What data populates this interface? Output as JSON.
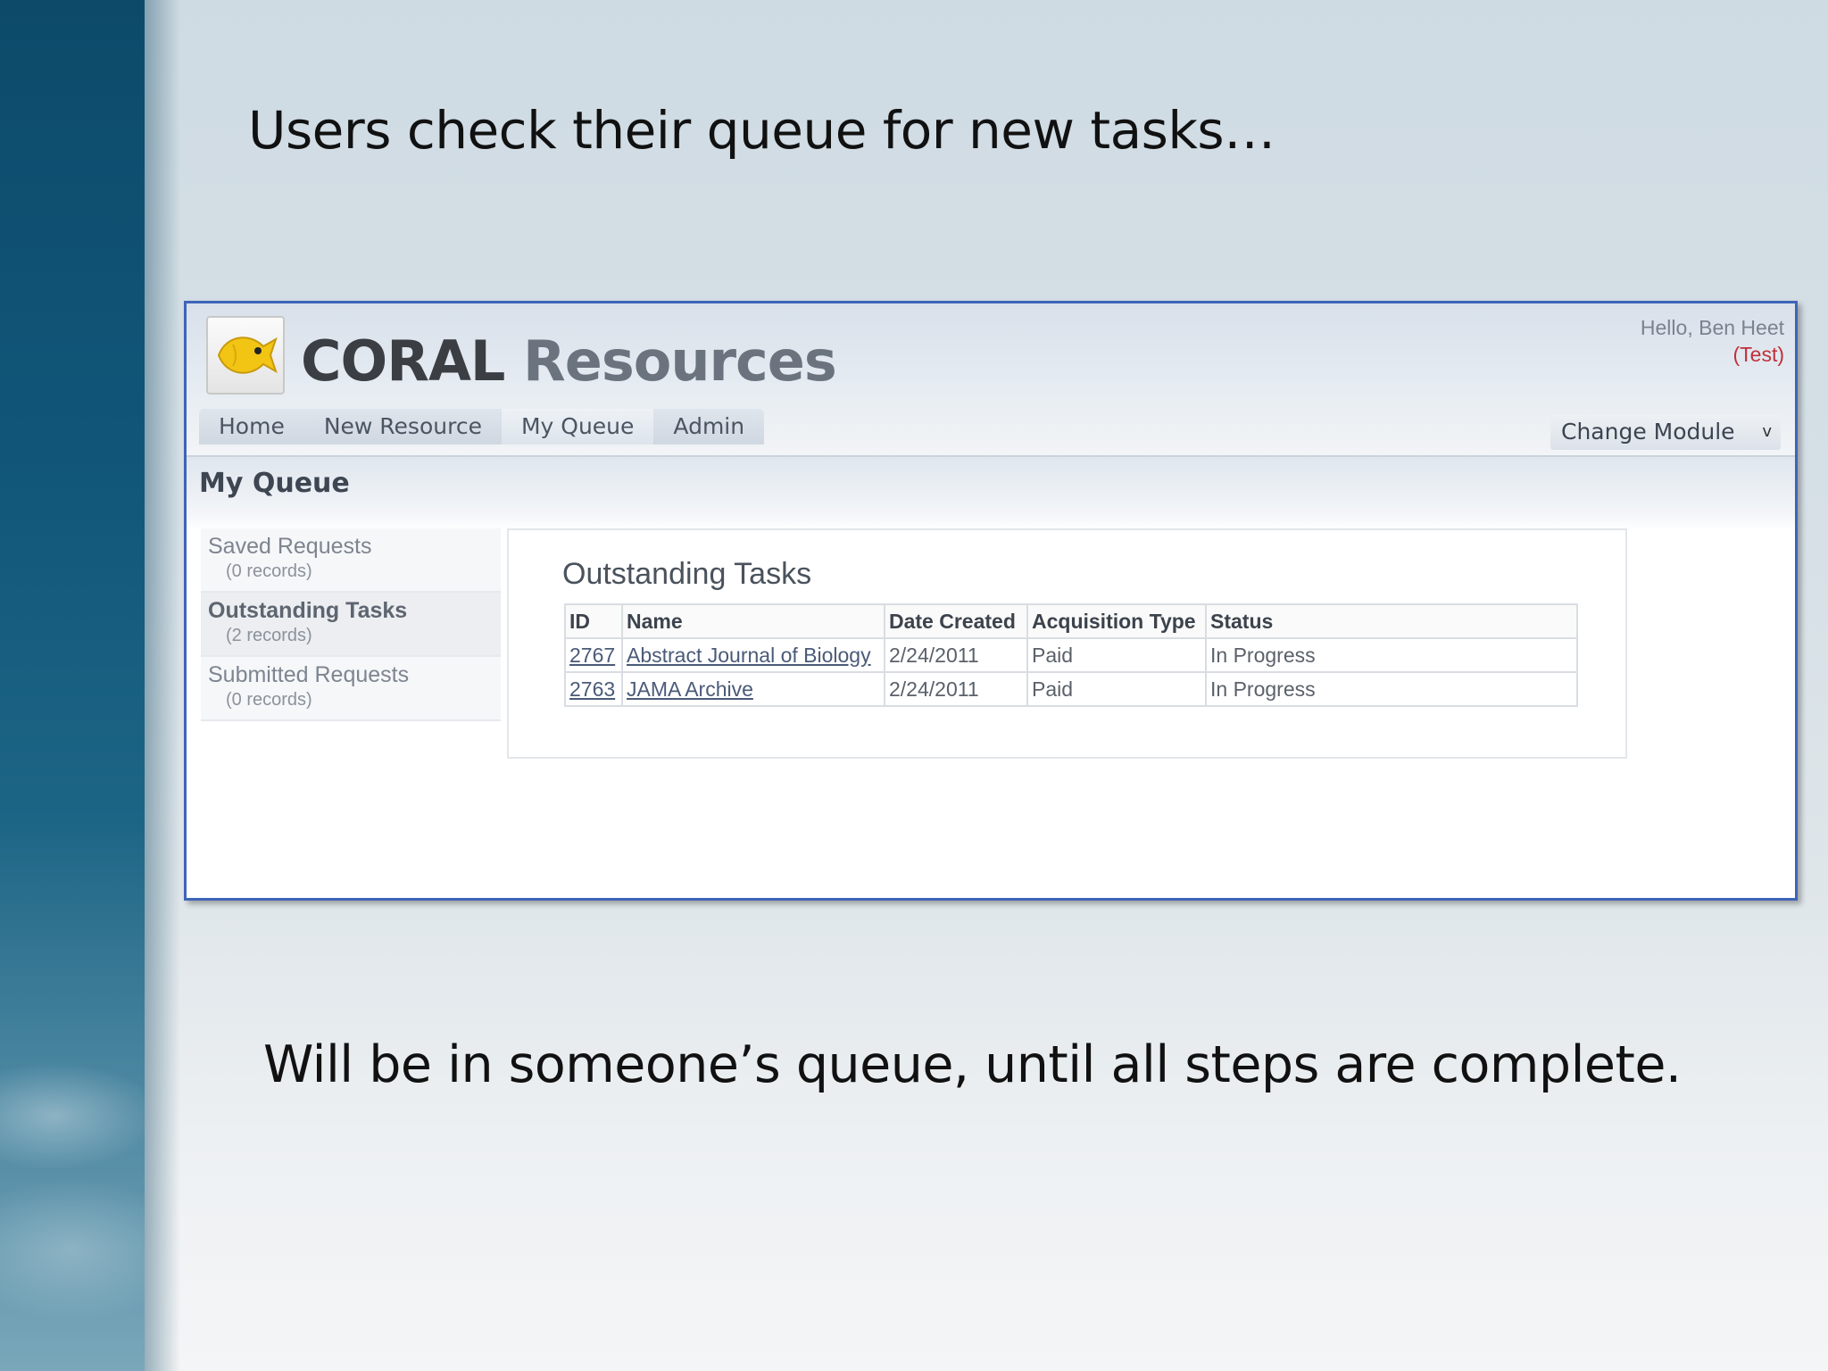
{
  "slide": {
    "title": "Users check their queue for new tasks…",
    "caption": "Will be in someone’s queue, until all steps are complete."
  },
  "app": {
    "brand_primary": "CORAL",
    "brand_secondary": "Resources",
    "greeting": "Hello, Ben Heet",
    "mode": "(Test)",
    "nav": [
      "Home",
      "New Resource",
      "My Queue",
      "Admin"
    ],
    "change_module": "Change Module",
    "change_module_caret": "v",
    "page_title": "My Queue",
    "sidebar": [
      {
        "label": "Saved Requests",
        "count": "(0 records)"
      },
      {
        "label": "Outstanding Tasks",
        "count": "(2 records)"
      },
      {
        "label": "Submitted Requests",
        "count": "(0 records)"
      }
    ],
    "panel_title": "Outstanding Tasks",
    "table": {
      "headers": [
        "ID",
        "Name",
        "Date Created",
        "Acquisition Type",
        "Status"
      ],
      "rows": [
        [
          "2767",
          "Abstract Journal of Biology",
          "2/24/2011",
          "Paid",
          "In Progress"
        ],
        [
          "2763",
          "JAMA Archive",
          "2/24/2011",
          "Paid",
          "In Progress"
        ]
      ]
    }
  },
  "colors": {
    "frame_border": "#3f64b8",
    "test_mode": "#c0303a",
    "fish_yellow": "#f2c514"
  }
}
